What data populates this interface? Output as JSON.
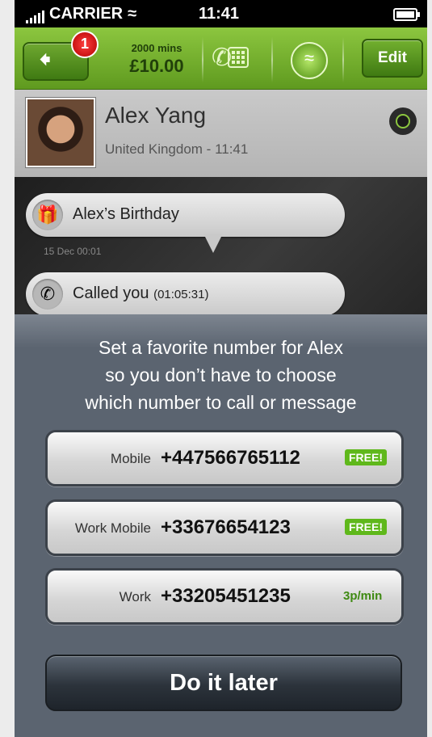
{
  "status_bar": {
    "carrier": "CARRIER",
    "time": "11:41"
  },
  "toolbar": {
    "badge_count": "1",
    "credit_mins": "2000 mins",
    "credit_amount": "£10.00",
    "edit_label": "Edit"
  },
  "contact": {
    "name": "Alex Yang",
    "location": "United Kingdom - 11:41"
  },
  "messages": [
    {
      "icon": "gift-icon",
      "text": "Alex’s Birthday",
      "timestamp": "15 Dec 00:01"
    },
    {
      "icon": "incoming-call-icon",
      "text": "Called you",
      "detail": "(01:05:31)"
    }
  ],
  "prompt": {
    "line1": "Set a favorite number for Alex",
    "line2": "so you don’t have to choose",
    "line3": "which number to call or message"
  },
  "numbers": [
    {
      "label": "Mobile",
      "number": "+447566765112",
      "tag": "FREE!"
    },
    {
      "label": "Work Mobile",
      "number": "+33676654123",
      "tag": "FREE!"
    },
    {
      "label": "Work",
      "number": "+33205451235",
      "tag": "3p/min"
    }
  ],
  "later_label": "Do it later",
  "colors": {
    "brand_green": "#8cc63f",
    "free_tag": "#5fb81b",
    "overlay": "#5b6470"
  }
}
